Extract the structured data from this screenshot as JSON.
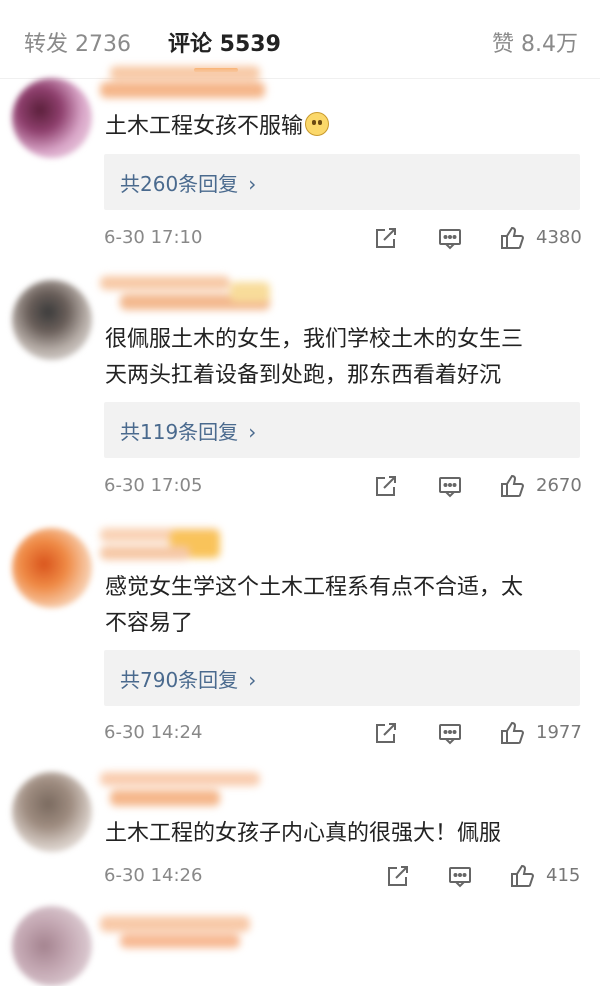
{
  "tabs": {
    "repost": "转发 2736",
    "comments": "评论 5539",
    "likes": "赞 8.4万"
  },
  "comments": [
    {
      "text_lines": [
        "土木工程女孩不服输"
      ],
      "has_emoji": true,
      "replies": "共260条回复",
      "time": "6-30 17:10",
      "likes": "4380"
    },
    {
      "text_lines": [
        "很佩服土木的女生，我们学校土木的女生三",
        "天两头扛着设备到处跑，那东西看着好沉"
      ],
      "replies": "共119条回复",
      "time": "6-30 17:05",
      "likes": "2670"
    },
    {
      "text_lines": [
        "感觉女生学这个土木工程系有点不合适，太",
        "不容易了"
      ],
      "replies": "共790条回复",
      "time": "6-30 14:24",
      "likes": "1977"
    },
    {
      "text_lines": [
        "土木工程的女孩子内心真的很强大！佩服"
      ],
      "time": "6-30 14:26",
      "likes": "415"
    }
  ],
  "icons": {
    "repost": "repost-icon",
    "comment": "comment-icon",
    "like": "thumbs-up-icon",
    "chevron": "›"
  },
  "colors": {
    "accent": "#ff8200",
    "link": "#4a6a8e"
  }
}
